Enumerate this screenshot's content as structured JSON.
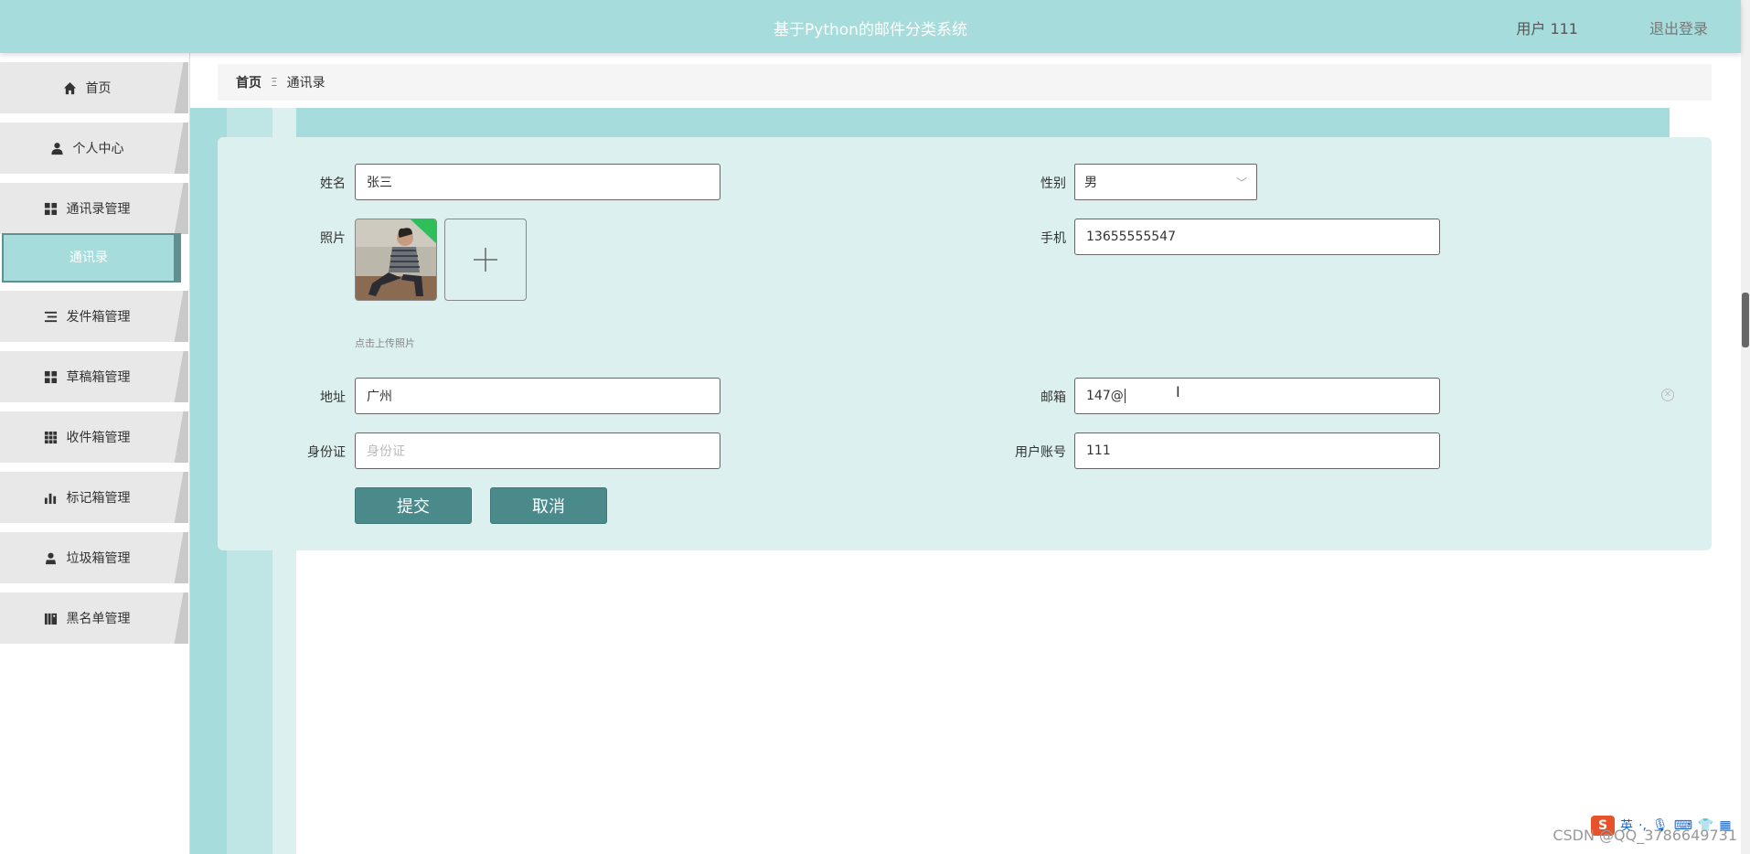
{
  "app": {
    "title": "基于Python的邮件分类系统",
    "user_label": "用户 111",
    "logout_label": "退出登录"
  },
  "sidebar": {
    "items": [
      {
        "label": "首页",
        "icon": "home-icon"
      },
      {
        "label": "个人中心",
        "icon": "person-icon"
      },
      {
        "label": "通讯录管理",
        "icon": "grid-icon"
      },
      {
        "label": "发件箱管理",
        "icon": "list-icon"
      },
      {
        "label": "草稿箱管理",
        "icon": "grid-icon"
      },
      {
        "label": "收件箱管理",
        "icon": "apps-icon"
      },
      {
        "label": "标记箱管理",
        "icon": "bar-chart-icon"
      },
      {
        "label": "垃圾箱管理",
        "icon": "user-icon"
      },
      {
        "label": "黑名单管理",
        "icon": "book-icon"
      }
    ],
    "active_sub": "通讯录"
  },
  "breadcrumb": {
    "home": "首页",
    "sep": "Ξ",
    "current": "通讯录"
  },
  "form": {
    "name_label": "姓名",
    "name_value": "张三",
    "gender_label": "性别",
    "gender_value": "男",
    "photo_label": "照片",
    "photo_hint": "点击上传照片",
    "phone_label": "手机",
    "phone_value": "13655555547",
    "address_label": "地址",
    "address_value": "广州",
    "email_label": "邮箱",
    "email_value": "147@",
    "id_label": "身份证",
    "id_placeholder": "身份证",
    "account_label": "用户账号",
    "account_value": "111",
    "submit_label": "提交",
    "cancel_label": "取消"
  },
  "overlay": {
    "watermark": "CSDN @QQ_3786649731",
    "ime_lang": "英"
  },
  "colors": {
    "header_bg": "#a7dcdc",
    "card_bg": "#dcf0ef",
    "button_bg": "#4b8a8a"
  }
}
